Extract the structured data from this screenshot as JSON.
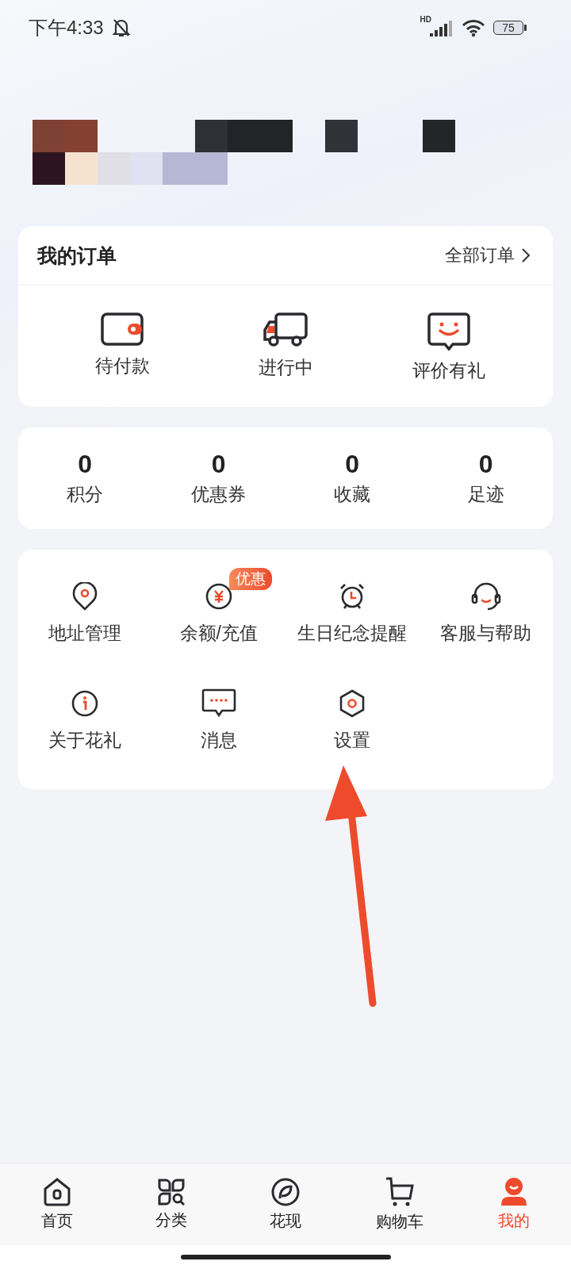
{
  "status_bar": {
    "time": "下午4:33",
    "network": "HD",
    "battery": "75"
  },
  "orders": {
    "title": "我的订单",
    "link": "全部订单",
    "items": [
      {
        "kind": "wallet",
        "label": "待付款"
      },
      {
        "kind": "truck",
        "label": "进行中"
      },
      {
        "kind": "smile",
        "label": "评价有礼"
      }
    ]
  },
  "stats": [
    {
      "value": "0",
      "label": "积分"
    },
    {
      "value": "0",
      "label": "优惠券"
    },
    {
      "value": "0",
      "label": "收藏"
    },
    {
      "value": "0",
      "label": "足迹"
    }
  ],
  "services": [
    {
      "kind": "pin",
      "label": "地址管理"
    },
    {
      "kind": "yen",
      "label": "余额/充值",
      "badge": "优惠"
    },
    {
      "kind": "alarm",
      "label": "生日纪念提醒"
    },
    {
      "kind": "headset",
      "label": "客服与帮助"
    },
    {
      "kind": "info",
      "label": "关于花礼"
    },
    {
      "kind": "message",
      "label": "消息"
    },
    {
      "kind": "hexagon",
      "label": "设置"
    }
  ],
  "tab_bar": [
    {
      "kind": "home",
      "label": "首页",
      "selected": false
    },
    {
      "kind": "grid",
      "label": "分类",
      "selected": false
    },
    {
      "kind": "leaf",
      "label": "花现",
      "selected": false
    },
    {
      "kind": "cart",
      "label": "购物车",
      "selected": false
    },
    {
      "kind": "person",
      "label": "我的",
      "selected": true
    }
  ]
}
